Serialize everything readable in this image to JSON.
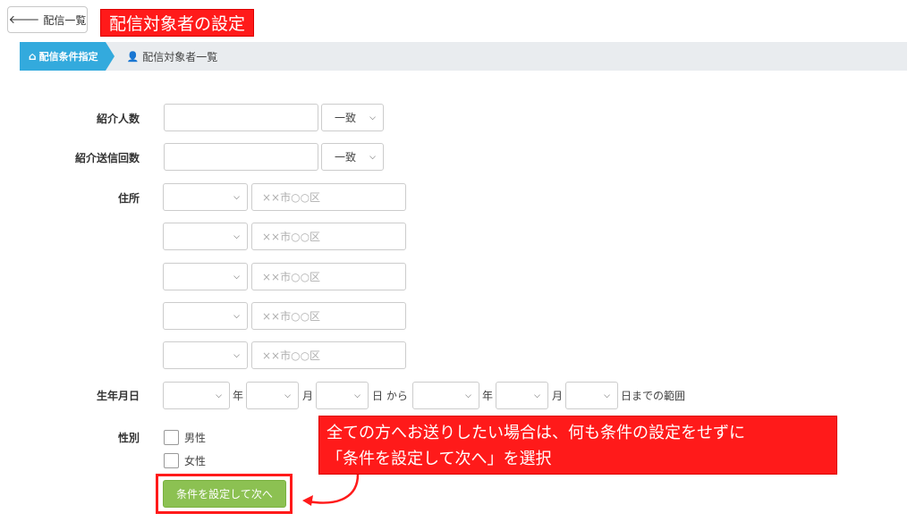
{
  "header": {
    "back_label": "配信一覧",
    "title": "配信対象者の設定"
  },
  "breadcrumb": {
    "active": "配信条件指定",
    "second": "配信対象者一覧"
  },
  "form": {
    "referral_count": {
      "label": "紹介人数",
      "value": "",
      "match": "一致"
    },
    "referral_send_count": {
      "label": "紹介送信回数",
      "value": "",
      "match": "一致"
    },
    "address": {
      "label": "住所",
      "rows": [
        {
          "pref": "",
          "placeholder": "××市○○区"
        },
        {
          "pref": "",
          "placeholder": "××市○○区"
        },
        {
          "pref": "",
          "placeholder": "××市○○区"
        },
        {
          "pref": "",
          "placeholder": "××市○○区"
        },
        {
          "pref": "",
          "placeholder": "××市○○区"
        }
      ]
    },
    "birthdate": {
      "label": "生年月日",
      "year_unit": "年",
      "month_unit": "月",
      "day_from": "日 から",
      "year_unit2": "年",
      "month_unit2": "月",
      "day_to": "日までの範囲"
    },
    "gender": {
      "label": "性別",
      "options": [
        "男性",
        "女性"
      ],
      "checked": [
        false,
        false
      ]
    },
    "submit_label": "条件を設定して次へ"
  },
  "annotation": {
    "line1": "全ての方へお送りしたい場合は、何も条件の設定をせずに",
    "line2": "「条件を設定して次へ」を選択"
  },
  "colors": {
    "accent_blue": "#33aadd",
    "submit_green": "#8cc152",
    "annotation_red": "#ff1a1a"
  }
}
